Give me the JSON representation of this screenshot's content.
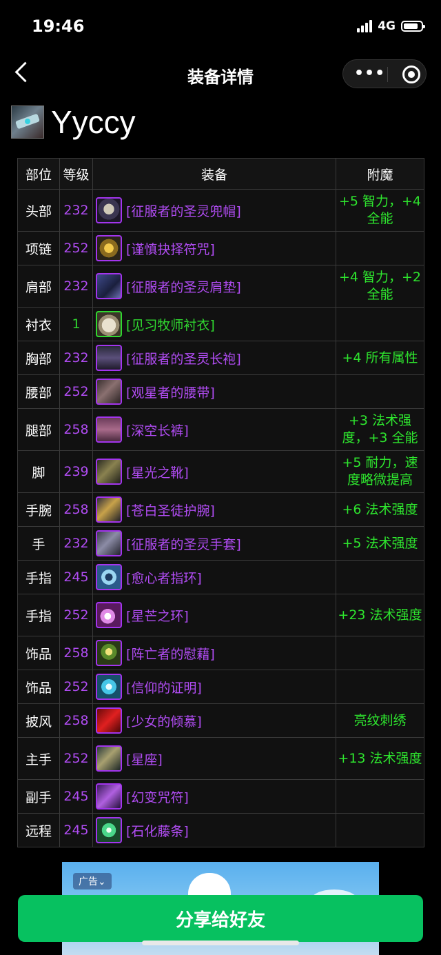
{
  "status": {
    "time": "19:46",
    "network": "4G"
  },
  "nav": {
    "title": "装备详情",
    "more_label": "•••"
  },
  "player": {
    "name": "Yyccy",
    "icon": "weapon-class-icon"
  },
  "colors": {
    "epic": "#b04cf2",
    "common": "#30d830",
    "enchant": "#2ee62e",
    "share_button": "#07c160"
  },
  "table": {
    "headers": [
      "部位",
      "等级",
      "装备",
      "附魔"
    ],
    "rows": [
      {
        "slot": "头部",
        "level": "232",
        "item": "[征服者的圣灵兜帽]",
        "quality": "epic",
        "enchant": "+5 智力，+4 全能",
        "icon": "helm-icon"
      },
      {
        "slot": "项链",
        "level": "252",
        "item": "[谨慎抉择符咒]",
        "quality": "epic",
        "enchant": "",
        "icon": "amulet-icon"
      },
      {
        "slot": "肩部",
        "level": "232",
        "item": "[征服者的圣灵肩垫]",
        "quality": "epic",
        "enchant": "+4 智力，+2 全能",
        "icon": "shoulder-icon"
      },
      {
        "slot": "衬衣",
        "level": "1",
        "item": "[见习牧师衬衣]",
        "quality": "common",
        "enchant": "",
        "icon": "shirt-icon"
      },
      {
        "slot": "胸部",
        "level": "232",
        "item": "[征服者的圣灵长袍]",
        "quality": "epic",
        "enchant": "+4 所有属性",
        "icon": "robe-icon"
      },
      {
        "slot": "腰部",
        "level": "252",
        "item": "[观星者的腰带]",
        "quality": "epic",
        "enchant": "",
        "icon": "belt-icon"
      },
      {
        "slot": "腿部",
        "level": "258",
        "item": "[深空长裤]",
        "quality": "epic",
        "enchant": "+3 法术强度，+3 全能",
        "icon": "pants-icon"
      },
      {
        "slot": "脚",
        "level": "239",
        "item": "[星光之靴]",
        "quality": "epic",
        "enchant": "+5 耐力，速度略微提高",
        "icon": "boots-icon"
      },
      {
        "slot": "手腕",
        "level": "258",
        "item": "[苍白圣徒护腕]",
        "quality": "epic",
        "enchant": "+6 法术强度",
        "icon": "bracer-icon"
      },
      {
        "slot": "手",
        "level": "232",
        "item": "[征服者的圣灵手套]",
        "quality": "epic",
        "enchant": "+5 法术强度",
        "icon": "gloves-icon"
      },
      {
        "slot": "手指",
        "level": "245",
        "item": "[愈心者指环]",
        "quality": "epic",
        "enchant": "",
        "icon": "ring-icon"
      },
      {
        "slot": "手指",
        "level": "252",
        "item": "[星芒之环]",
        "quality": "epic",
        "enchant": "+23 法术强度",
        "icon": "star-ring-icon"
      },
      {
        "slot": "饰品",
        "level": "258",
        "item": "[阵亡者的慰藉]",
        "quality": "epic",
        "enchant": "",
        "icon": "trinket-orb-icon"
      },
      {
        "slot": "饰品",
        "level": "252",
        "item": "[信仰的证明]",
        "quality": "epic",
        "enchant": "",
        "icon": "trinket-shield-icon"
      },
      {
        "slot": "披风",
        "level": "258",
        "item": "[少女的倾慕]",
        "quality": "epic",
        "enchant": "亮纹刺绣",
        "icon": "cloak-icon"
      },
      {
        "slot": "主手",
        "level": "252",
        "item": "[星座]",
        "quality": "epic",
        "enchant": "+13 法术强度",
        "icon": "mainhand-icon"
      },
      {
        "slot": "副手",
        "level": "245",
        "item": "[幻变咒符]",
        "quality": "epic",
        "enchant": "",
        "icon": "offhand-icon"
      },
      {
        "slot": "远程",
        "level": "245",
        "item": "[石化藤条]",
        "quality": "epic",
        "enchant": "",
        "icon": "wand-icon"
      }
    ]
  },
  "ad": {
    "tag": "广告⌄"
  },
  "share": {
    "label": "分享给好友"
  }
}
